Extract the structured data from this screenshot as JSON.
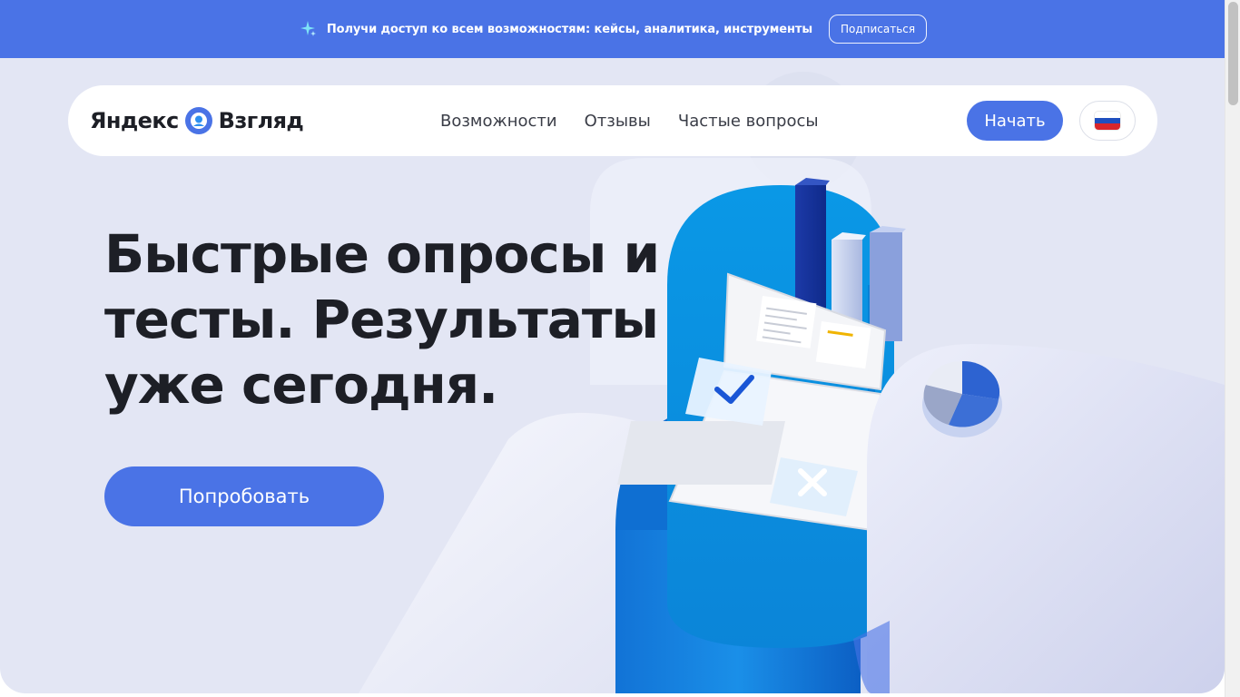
{
  "promo": {
    "icon": "sparkle-icon",
    "text": "Получи доступ ко всем возможностям: кейсы, аналитика, инструменты",
    "button_label": "Подписаться"
  },
  "header": {
    "logo_left": "Яндекс",
    "logo_right": "Взгляд",
    "nav": [
      {
        "label": "Возможности"
      },
      {
        "label": "Отзывы"
      },
      {
        "label": "Частые вопросы"
      }
    ],
    "start_label": "Начать",
    "language_flag": "ru-flag-icon"
  },
  "hero": {
    "headline": "Быстрые опросы и тесты. Результаты уже сегодня.",
    "cta_label": "Попробовать"
  },
  "colors": {
    "accent": "#4a73e6",
    "hero_bg": "#e3e6f4",
    "text_dark": "#1d1f26",
    "cylinder_blue": "#0d8fe0"
  }
}
